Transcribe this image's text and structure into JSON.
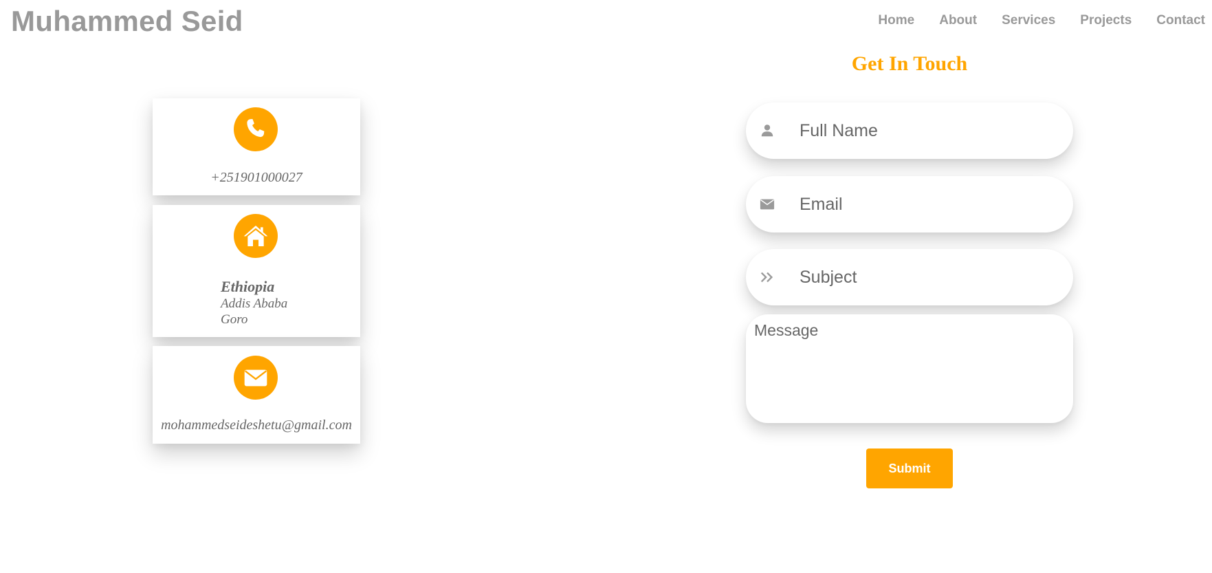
{
  "header": {
    "brand": "Muhammed Seid",
    "nav": [
      "Home",
      "About",
      "Services",
      "Projects",
      "Contact"
    ]
  },
  "contact": {
    "phone": "+251901000027",
    "address": {
      "country": "Ethiopia",
      "city": "Addis Ababa",
      "area": "Goro"
    },
    "email": "mohammedseideshetu@gmail.com"
  },
  "form": {
    "title": "Get In Touch",
    "full_name_placeholder": "Full Name",
    "email_placeholder": "Email",
    "subject_placeholder": "Subject",
    "message_placeholder": "Message",
    "submit_label": "Submit"
  },
  "icons": {
    "phone": "phone-icon",
    "home": "home-icon",
    "mail": "envelope-icon",
    "user": "user-icon",
    "email_field": "envelope-icon",
    "subject": "double-chevron-right-icon"
  },
  "colors": {
    "accent": "#FFA500",
    "text_muted": "#999999",
    "text_body": "#666666",
    "icon_gray": "#9a9a9a"
  }
}
